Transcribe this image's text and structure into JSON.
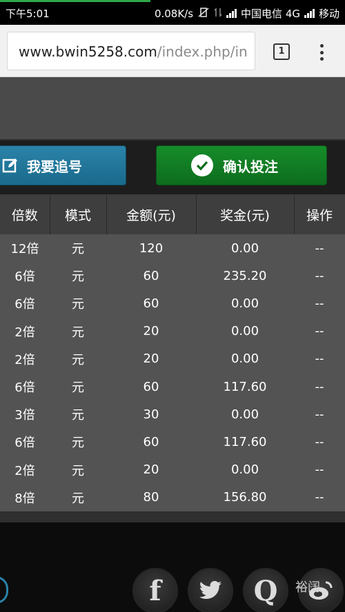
{
  "status_bar": {
    "time": "下午5:01",
    "net_speed": "0.08K/s",
    "carrier1": "中国电信 4G",
    "carrier2": "移动",
    "icon_vibrate": "vibrate-off-icon",
    "icon_data": "data-transfer-icon"
  },
  "browser": {
    "url_host": "www.bwin5258.com",
    "url_path": "/index.php/in",
    "tab_count": "1"
  },
  "actions": {
    "chase_label": "我要追号",
    "confirm_label": "确认投注"
  },
  "table": {
    "headers": [
      "倍数",
      "模式",
      "金额(元)",
      "奖金(元)",
      "操作"
    ],
    "rows": [
      [
        "12倍",
        "元",
        "120",
        "0.00",
        "--"
      ],
      [
        "6倍",
        "元",
        "60",
        "235.20",
        "--"
      ],
      [
        "6倍",
        "元",
        "60",
        "0.00",
        "--"
      ],
      [
        "2倍",
        "元",
        "20",
        "0.00",
        "--"
      ],
      [
        "2倍",
        "元",
        "20",
        "0.00",
        "--"
      ],
      [
        "6倍",
        "元",
        "60",
        "117.60",
        "--"
      ],
      [
        "3倍",
        "元",
        "30",
        "0.00",
        "--"
      ],
      [
        "6倍",
        "元",
        "60",
        "117.60",
        "--"
      ],
      [
        "2倍",
        "元",
        "20",
        "0.00",
        "--"
      ],
      [
        "8倍",
        "元",
        "80",
        "156.80",
        "--"
      ]
    ]
  },
  "social": {
    "facebook": "f",
    "qq": "Q",
    "watermark": "裕阔"
  },
  "colors": {
    "chase_button": "#1f77a0",
    "confirm_button": "#117c24",
    "table_row": "#535353",
    "table_header": "#3e3e3e"
  }
}
